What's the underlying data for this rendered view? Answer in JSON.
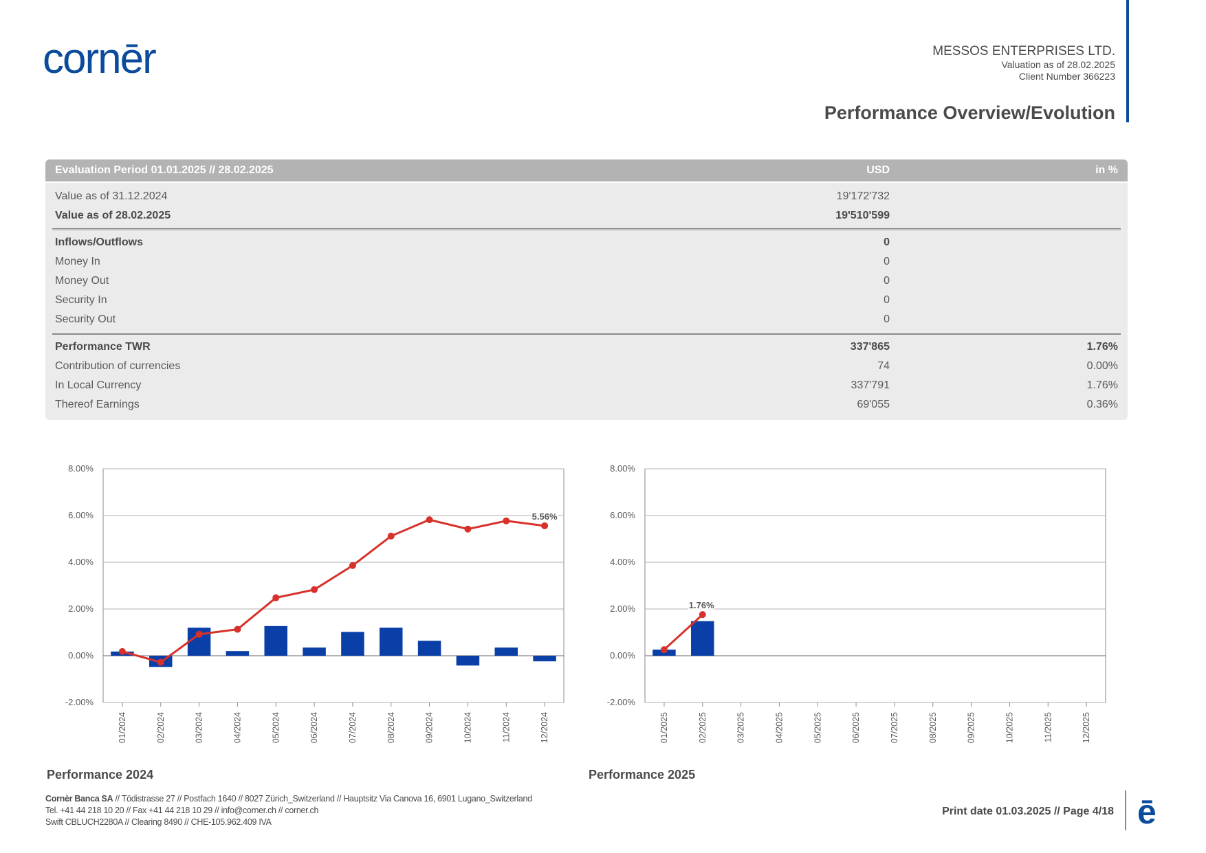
{
  "brand": {
    "logo_text": "cornēr",
    "logo_color": "#0b4b9c",
    "accent_color": "#d8312b"
  },
  "header": {
    "company": "MESSOS ENTERPRISES LTD.",
    "valuation": "Valuation as of 28.02.2025",
    "client": "Client Number 366223",
    "page_title": "Performance Overview/Evolution"
  },
  "table": {
    "header": {
      "period": "Evaluation Period 01.01.2025 // 28.02.2025",
      "usd": "USD",
      "pct": "in %"
    },
    "rows": [
      {
        "label": "Value as of 31.12.2024",
        "usd": "19'172'732",
        "pct": ""
      },
      {
        "label": "Value as of 28.02.2025",
        "usd": "19'510'599",
        "pct": ""
      },
      {
        "label": "Inflows/Outflows",
        "usd": "0",
        "pct": ""
      },
      {
        "label": "Money In",
        "usd": "0",
        "pct": ""
      },
      {
        "label": "Money Out",
        "usd": "0",
        "pct": ""
      },
      {
        "label": "Security In",
        "usd": "0",
        "pct": ""
      },
      {
        "label": "Security Out",
        "usd": "0",
        "pct": ""
      },
      {
        "label": "Performance TWR",
        "usd": "337'865",
        "pct": "1.76%"
      },
      {
        "label": "Contribution of currencies",
        "usd": "74",
        "pct": "0.00%"
      },
      {
        "label": "In Local Currency",
        "usd": "337'791",
        "pct": "1.76%"
      },
      {
        "label": "Thereof Earnings",
        "usd": "69'055",
        "pct": "0.36%"
      }
    ]
  },
  "chart_data": [
    {
      "type": "bar",
      "title": "Performance 2024",
      "categories": [
        "01/2024",
        "02/2024",
        "03/2024",
        "04/2024",
        "05/2024",
        "06/2024",
        "07/2024",
        "08/2024",
        "09/2024",
        "10/2024",
        "11/2024",
        "12/2024"
      ],
      "series": [
        {
          "type": "bar",
          "color": "#0a3fa8",
          "values": [
            0.18,
            -0.48,
            1.2,
            0.2,
            1.27,
            0.35,
            1.02,
            1.2,
            0.64,
            -0.42,
            0.35,
            -0.24
          ]
        },
        {
          "type": "line",
          "color": "#d8312b",
          "values": [
            0.18,
            -0.28,
            0.92,
            1.13,
            2.48,
            2.83,
            3.86,
            5.12,
            5.82,
            5.42,
            5.77,
            5.56
          ]
        }
      ],
      "end_label": "5.56%",
      "yticks": [
        "8.00%",
        "6.00%",
        "4.00%",
        "2.00%",
        "0.00%",
        "-2.00%"
      ],
      "ylim": [
        -2,
        8
      ],
      "grid": true
    },
    {
      "type": "bar",
      "title": "Performance 2025",
      "categories": [
        "01/2025",
        "02/2025",
        "03/2025",
        "04/2025",
        "05/2025",
        "06/2025",
        "07/2025",
        "08/2025",
        "09/2025",
        "10/2025",
        "11/2025",
        "12/2025"
      ],
      "series": [
        {
          "type": "bar",
          "color": "#0a3fa8",
          "values": [
            0.26,
            1.48,
            null,
            null,
            null,
            null,
            null,
            null,
            null,
            null,
            null,
            null
          ]
        },
        {
          "type": "line",
          "color": "#d8312b",
          "values": [
            0.26,
            1.76,
            null,
            null,
            null,
            null,
            null,
            null,
            null,
            null,
            null,
            null
          ]
        }
      ],
      "end_label": "1.76%",
      "yticks": [
        "8.00%",
        "6.00%",
        "4.00%",
        "2.00%",
        "0.00%",
        "-2.00%"
      ],
      "ylim": [
        -2,
        8
      ],
      "grid": true
    }
  ],
  "footer": {
    "bank_name": "Cornèr Banca SA",
    "addr1": " // Tödistrasse 27 // Postfach 1640 // 8027 Zürich_Switzerland // Hauptsitz Via Canova 16, 6901 Lugano_Switzerland",
    "addr2": "Tel. +41 44 218 10 20 // Fax +41 44 218 10 29 // info@corner.ch // corner.ch",
    "addr3": "Swift CBLUCH2280A // Clearing 8490 // CHE-105.962.409 IVA",
    "print_date": "Print date 01.03.2025 // Page 4/18",
    "small_logo": "ē"
  }
}
